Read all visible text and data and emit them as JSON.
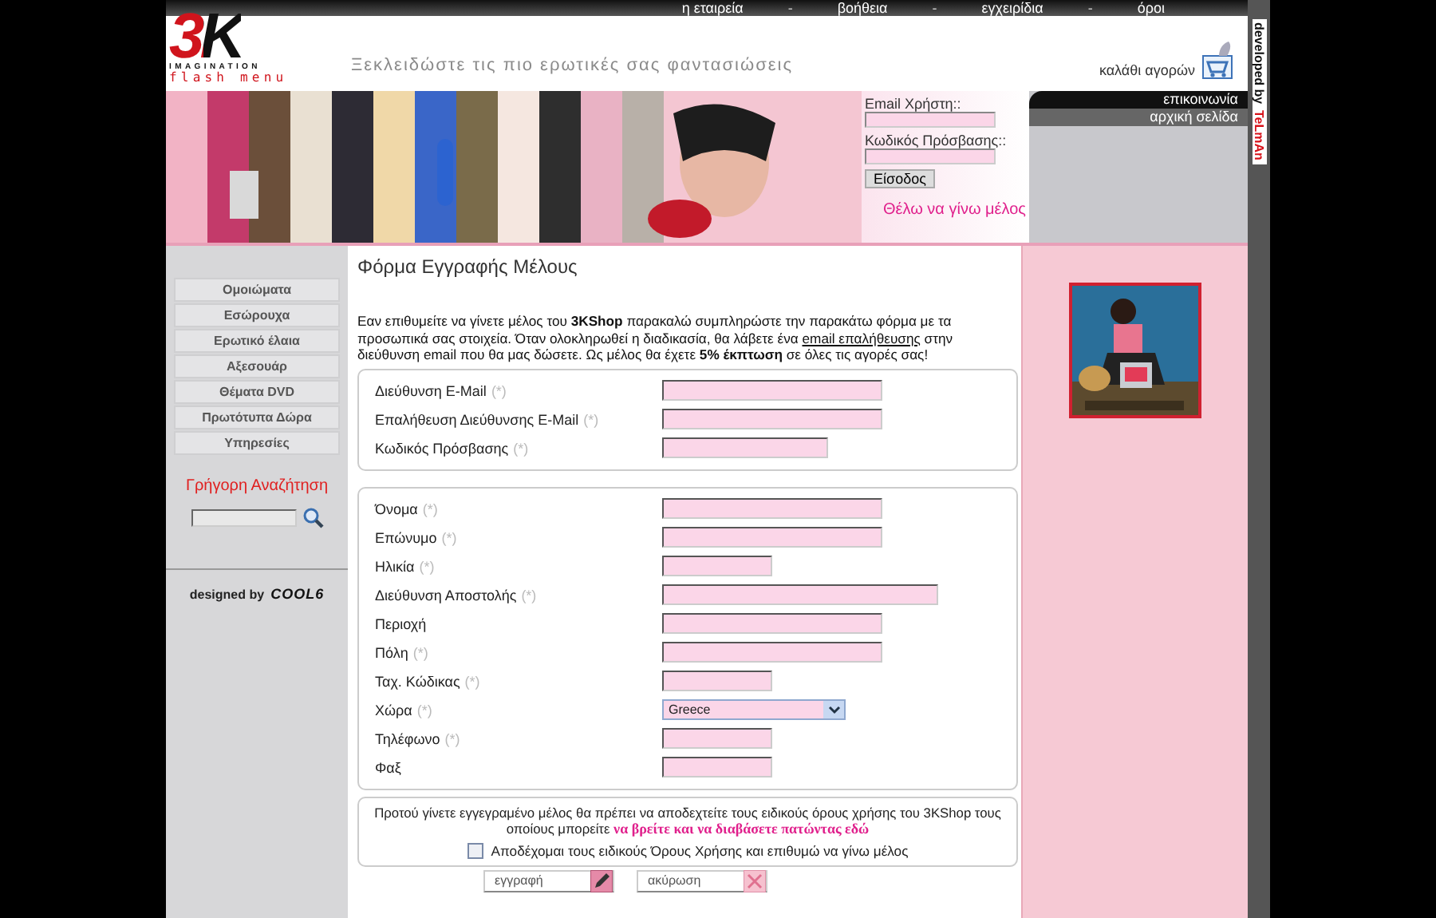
{
  "top_nav": [
    {
      "kind": "link",
      "label": "η εταιρεία"
    },
    {
      "kind": "separator",
      "label": "-"
    },
    {
      "kind": "link",
      "label": "βοήθεια"
    },
    {
      "kind": "separator",
      "label": "-"
    },
    {
      "kind": "link",
      "label": "εγχειρίδια"
    },
    {
      "kind": "separator",
      "label": "-"
    },
    {
      "kind": "link",
      "label": "όροι"
    }
  ],
  "logo": {
    "mark": "3K",
    "subtitle": "IMAGINATION",
    "caption": "flash menu"
  },
  "tagline": "Ξεκλειδώστε τις πιο ερωτικές σας φαντασιώσεις",
  "cart": {
    "label": "καλάθι αγορών"
  },
  "login": {
    "email_label": "Email Χρήστη::",
    "password_label": "Κωδικός Πρόσβασης::",
    "submit": "Είσοδος",
    "signup_link": "Θέλω να γίνω μέλος"
  },
  "side_tabs": [
    {
      "kind": "dark",
      "label": "επικοινωνία"
    },
    {
      "kind": "grey",
      "label": "αρχική σελίδα"
    }
  ],
  "credit": {
    "prefix": "developed by",
    "brand": "TeLmAn"
  },
  "menu": [
    {
      "label": "Ομοιώματα"
    },
    {
      "label": "Εσώρουχα"
    },
    {
      "label": "Ερωτικό έλαια"
    },
    {
      "label": "Αξεσουάρ"
    },
    {
      "label": "Θέματα DVD"
    },
    {
      "label": "Πρωτότυπα Δώρα"
    },
    {
      "label": "Υπηρεσίες"
    }
  ],
  "quick_search": {
    "title": "Γρήγορη Αναζήτηση"
  },
  "designer": {
    "prefix": "designed by",
    "brand": "COOL6"
  },
  "form": {
    "title": "Φόρμα Εγγραφής Μέλους",
    "intro": {
      "before": "Εαν επιθυμείτε να γίνετε μέλος του **3KShop** παρακαλώ συμπληρώστε την παρακάτω φόρμα με τα προσωπικά σας στοιχεία. Όταν ολοκληρωθεί η διαδικασία, θα λάβετε ένα",
      "link": "email επαλήθευσης",
      "after": "στην διεύθυνση email που θα μας δώσετε. Ως μέλος θα έχετε **5% έκπτωση** σε όλες τις αγορές σας!"
    },
    "groups": [
      [
        {
          "label": "Διεύθυνση E-Mail",
          "mark": "(*)",
          "kind": "medium"
        },
        {
          "label": "Επαλήθευση Διεύθυνσης E-Mail",
          "mark": "(*)",
          "kind": "medium"
        },
        {
          "label": "Κωδικός Πρόσβασης",
          "mark": "(*)",
          "kind": "mid"
        }
      ],
      [
        {
          "label": "Όνομα",
          "mark": "(*)",
          "kind": "medium"
        },
        {
          "label": "Επώνυμο",
          "mark": "(*)",
          "kind": "medium"
        },
        {
          "label": "Ηλικία",
          "mark": "(*)",
          "kind": "short"
        },
        {
          "label": "Διεύθυνση Αποστολής",
          "mark": "(*)",
          "kind": "long"
        },
        {
          "label": "Περιοχή",
          "kind": "medium"
        },
        {
          "label": "Πόλη",
          "mark": "(*)",
          "kind": "medium"
        },
        {
          "label": "Ταχ. Κώδικας",
          "mark": "(*)",
          "kind": "short"
        },
        {
          "label": "Χώρα",
          "mark": "(*)",
          "kind": "select",
          "value": "Greece"
        },
        {
          "label": "Τηλέφωνο",
          "mark": "(*)",
          "kind": "short"
        },
        {
          "label": "Φαξ",
          "kind": "short"
        }
      ]
    ],
    "terms": {
      "before": "Προτού γίνετε εγγεγραμένο μέλος θα πρέπει να αποδεχτείτε τους ειδικούς όρους χρήσης του 3KShop τους οποίους μπορείτε",
      "link": "να βρείτε και να διαβάσετε πατώντας εδώ",
      "checkbox": {
        "label": "Αποδέχομαι τους ειδικούς Όρους Χρήσης και επιθυμώ να γίνω μέλος",
        "checked": false
      }
    },
    "buttons": [
      {
        "kind": "submit",
        "label": "εγγραφή"
      },
      {
        "kind": "cancel",
        "label": "ακύρωση"
      }
    ]
  }
}
